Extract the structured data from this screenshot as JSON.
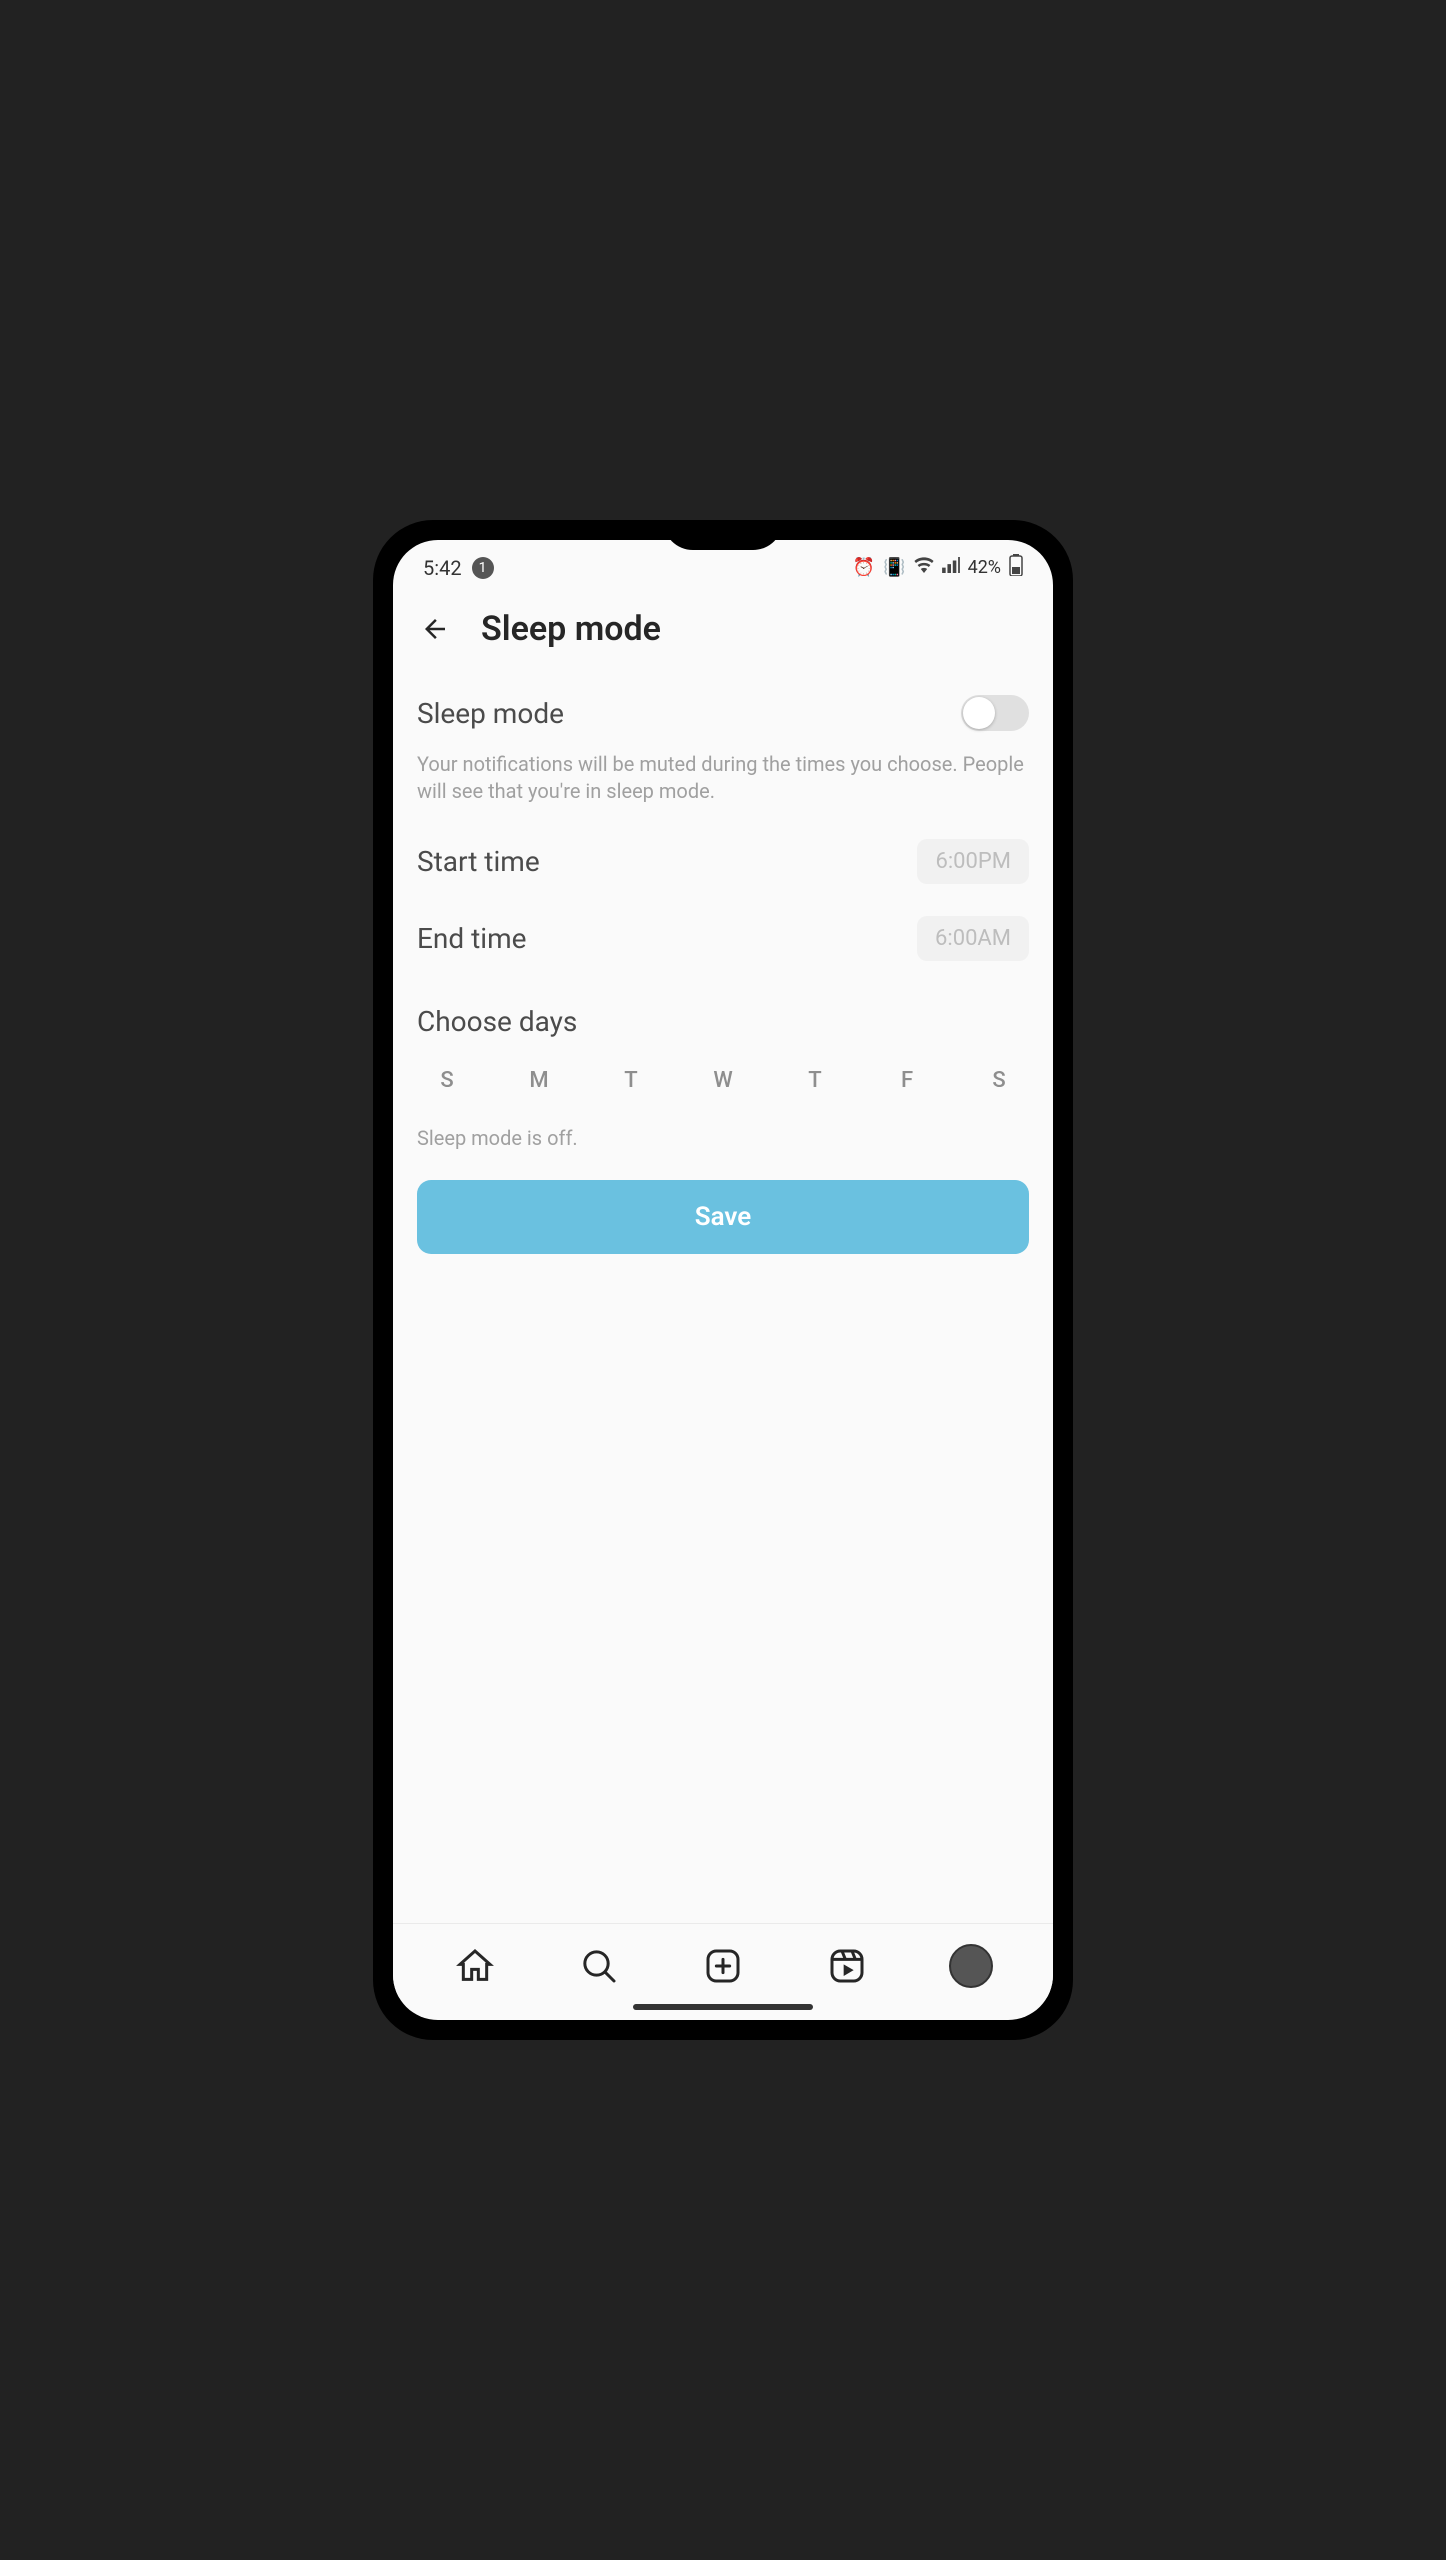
{
  "status_bar": {
    "time": "5:42",
    "notif_count": "1",
    "battery": "42%"
  },
  "header": {
    "title": "Sleep mode"
  },
  "sleep": {
    "toggle_label": "Sleep mode",
    "toggle_on": false,
    "description": "Your notifications will be muted during the times you choose. People will see that you're in sleep mode.",
    "start": {
      "label": "Start time",
      "value": "6:00PM"
    },
    "end": {
      "label": "End time",
      "value": "6:00AM"
    },
    "choose_days_label": "Choose days",
    "days": [
      "S",
      "M",
      "T",
      "W",
      "T",
      "F",
      "S"
    ],
    "status_text": "Sleep mode is off.",
    "save_label": "Save"
  },
  "nav": {
    "home": "home",
    "search": "search",
    "create": "create",
    "reels": "reels",
    "profile": "profile"
  }
}
